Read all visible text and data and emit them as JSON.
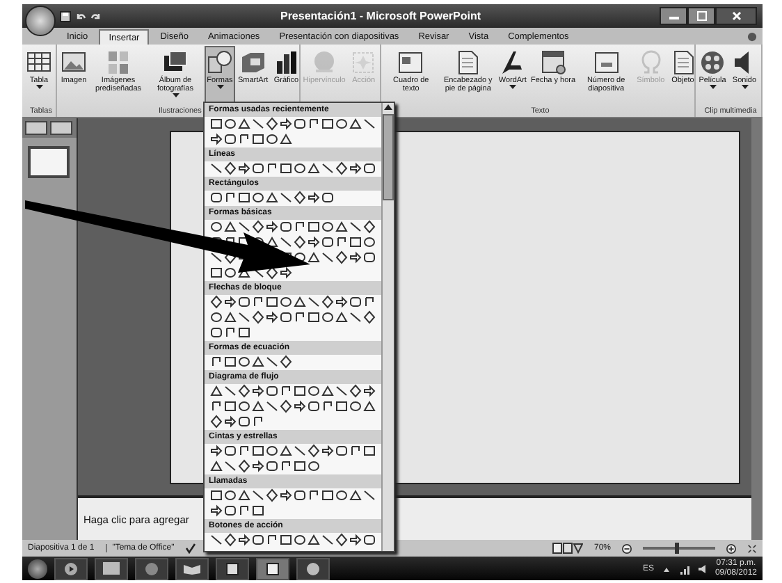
{
  "window": {
    "title": "Presentación1 - Microsoft PowerPoint"
  },
  "tabs": [
    {
      "label": "Inicio",
      "selected": false
    },
    {
      "label": "Insertar",
      "selected": true
    },
    {
      "label": "Diseño",
      "selected": false
    },
    {
      "label": "Animaciones",
      "selected": false
    },
    {
      "label": "Presentación con diapositivas",
      "selected": false
    },
    {
      "label": "Revisar",
      "selected": false
    },
    {
      "label": "Vista",
      "selected": false
    },
    {
      "label": "Complementos",
      "selected": false
    }
  ],
  "ribbon": {
    "groups": [
      {
        "label": "Tablas",
        "items": [
          {
            "label": "Tabla",
            "dropdown": true,
            "disabled": false,
            "selected": false
          }
        ]
      },
      {
        "label": "Ilustraciones",
        "items": [
          {
            "label": "Imagen",
            "dropdown": false,
            "disabled": false,
            "selected": false
          },
          {
            "label": "Imágenes prediseñadas",
            "dropdown": false,
            "disabled": false,
            "selected": false
          },
          {
            "label": "Álbum de fotografías",
            "dropdown": true,
            "disabled": false,
            "selected": false
          },
          {
            "label": "Formas",
            "dropdown": true,
            "disabled": false,
            "selected": true
          },
          {
            "label": "SmartArt",
            "dropdown": false,
            "disabled": false,
            "selected": false
          },
          {
            "label": "Gráfico",
            "dropdown": false,
            "disabled": false,
            "selected": false
          }
        ]
      },
      {
        "items": [
          {
            "label": "Hipervínculo",
            "dropdown": false,
            "disabled": true,
            "selected": false
          },
          {
            "label": "Acción",
            "dropdown": false,
            "disabled": true,
            "selected": false
          }
        ]
      },
      {
        "label": "Texto",
        "items": [
          {
            "label": "Cuadro de texto",
            "dropdown": false,
            "disabled": false,
            "selected": false
          },
          {
            "label": "Encabezado y pie de página",
            "dropdown": false,
            "disabled": false,
            "selected": false
          },
          {
            "label": "WordArt",
            "dropdown": true,
            "disabled": false,
            "selected": false
          },
          {
            "label": "Fecha y hora",
            "dropdown": false,
            "disabled": false,
            "selected": false
          },
          {
            "label": "Número de diapositiva",
            "dropdown": false,
            "disabled": false,
            "selected": false
          },
          {
            "label": "Símbolo",
            "dropdown": false,
            "disabled": true,
            "selected": false
          },
          {
            "label": "Objeto",
            "dropdown": false,
            "disabled": false,
            "selected": false
          }
        ]
      },
      {
        "label": "Clip multimedia",
        "items": [
          {
            "label": "Película",
            "dropdown": true,
            "disabled": false,
            "selected": false
          },
          {
            "label": "Sonido",
            "dropdown": true,
            "disabled": false,
            "selected": false
          }
        ]
      }
    ]
  },
  "shapes_gallery": {
    "sections": [
      {
        "title": "Formas usadas recientemente"
      },
      {
        "title": "Líneas"
      },
      {
        "title": "Rectángulos"
      },
      {
        "title": "Formas básicas"
      },
      {
        "title": "Flechas de bloque"
      },
      {
        "title": "Formas de ecuación"
      },
      {
        "title": "Diagrama de flujo"
      },
      {
        "title": "Cintas y estrellas"
      },
      {
        "title": "Llamadas"
      },
      {
        "title": "Botones de acción"
      }
    ]
  },
  "notes": {
    "placeholder": "Haga clic para agregar"
  },
  "status_bar": {
    "slide": "Diapositiva 1 de 1",
    "theme": "\"Tema de Office\"",
    "zoom": "70%",
    "zoom_level": {
      "level": 0.45
    }
  },
  "taskbar": {
    "language": "ES",
    "time": "07:31 p.m.",
    "date": "09/08/2012"
  }
}
